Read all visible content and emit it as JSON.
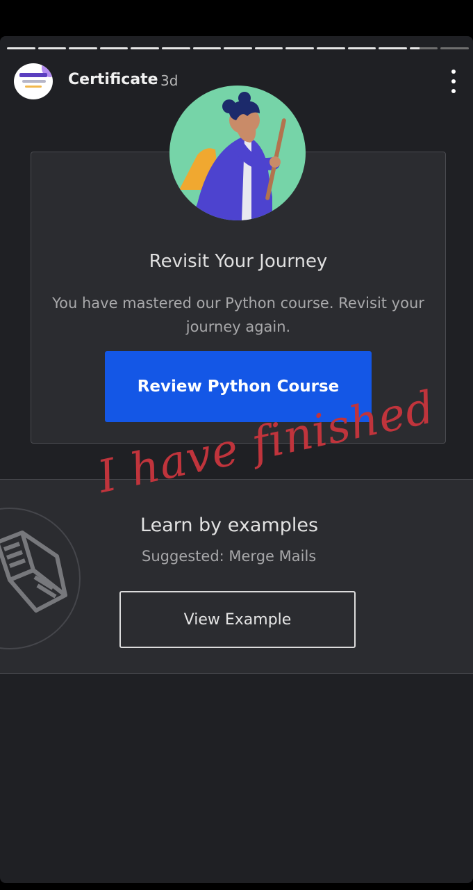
{
  "story": {
    "progress": {
      "segments_total": 15,
      "segments_completed": 13,
      "current_segment_fraction": 0.35
    },
    "user": {
      "name": "Certificate",
      "time_ago": "3d"
    },
    "menu_icon": "more-vertical-icon"
  },
  "card_journey": {
    "illustration": "hiker-illustration",
    "title": "Revisit Your Journey",
    "text": "You have mastered our Python course. Revisit your journey again.",
    "button_label": "Review Python Course",
    "colors": {
      "button": "#1457e6",
      "illustration_bg": "#76d4a8"
    }
  },
  "card_examples": {
    "icon": "open-book-icon",
    "title": "Learn by examples",
    "subtitle": "Suggested: Merge Mails",
    "button_label": "View Example"
  },
  "overlay": {
    "handwritten_text": "I have finished",
    "color": "#c0343c"
  }
}
